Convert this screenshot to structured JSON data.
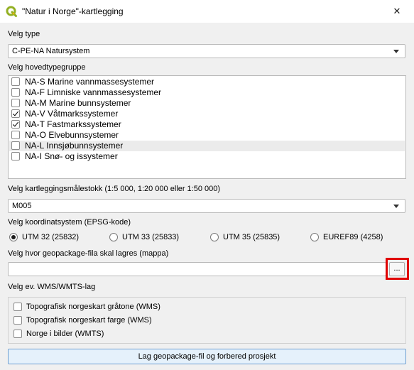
{
  "window": {
    "title": "\"Natur i Norge\"-kartlegging",
    "close_glyph": "✕",
    "app_icon": "qgis-logo-icon",
    "accent_color": "#93b023"
  },
  "type": {
    "label": "Velg type",
    "selected": "C-PE-NA Natursystem"
  },
  "hovedtypegruppe": {
    "label": "Velg hovedtypegruppe",
    "items": [
      {
        "label": "NA-S Marine vannmassesystemer",
        "checked": false
      },
      {
        "label": "NA-F Limniske vannmassesystemer",
        "checked": false
      },
      {
        "label": "NA-M Marine bunnsystemer",
        "checked": false
      },
      {
        "label": "NA-V Våtmarkssystemer",
        "checked": true
      },
      {
        "label": "NA-T Fastmarkssystemer",
        "checked": true
      },
      {
        "label": "NA-O Elvebunnsystemer",
        "checked": false
      },
      {
        "label": "NA-L Innsjøbunnsystemer",
        "checked": false,
        "hovered": true
      },
      {
        "label": "NA-I Snø- og issystemer",
        "checked": false
      }
    ]
  },
  "scale": {
    "label": "Velg kartleggingsmålestokk (1:5 000, 1:20 000 eller 1:50 000)",
    "selected": "M005"
  },
  "crs": {
    "label": "Velg koordinatsystem (EPSG-kode)",
    "options": [
      {
        "label": "UTM 32 (25832)",
        "selected": true
      },
      {
        "label": "UTM 33 (25833)",
        "selected": false
      },
      {
        "label": "UTM 35 (25835)",
        "selected": false
      },
      {
        "label": "EUREF89 (4258)",
        "selected": false
      }
    ]
  },
  "geopackage": {
    "label": "Velg hvor geopackage-fila skal lagres (mappa)",
    "path_value": "",
    "browse_label": "...",
    "highlight_color": "#e00000"
  },
  "wms": {
    "label": "Velg ev. WMS/WMTS-lag",
    "items": [
      {
        "label": "Topografisk norgeskart gråtone (WMS)",
        "checked": false
      },
      {
        "label": "Topografisk norgeskart farge (WMS)",
        "checked": false
      },
      {
        "label": "Norge i bilder (WMTS)",
        "checked": false
      }
    ]
  },
  "action": {
    "button_label": "Lag geopackage-fil og forbered prosjekt"
  }
}
